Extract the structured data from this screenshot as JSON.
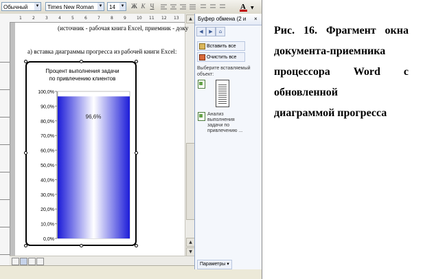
{
  "toolbar": {
    "style": "Обычный",
    "font": "Times New Roman",
    "size": "14",
    "buttons": [
      "Ж",
      "К",
      "Ч"
    ]
  },
  "ruler": {
    "marks": [
      "1",
      "2",
      "3",
      "4",
      "5",
      "6",
      "7",
      "8",
      "9",
      "10",
      "11",
      "12",
      "13"
    ]
  },
  "document": {
    "heading_line": "(источник - рабочая книга Excel, приемник - доку",
    "section_line": "а) вставка диаграммы прогресса из рабочей книги Excel:"
  },
  "chart_data": {
    "type": "bar",
    "title": "Процент выполнения задачи по привлечению клиентов",
    "title_lines": [
      "Процент выполнения задачи",
      "по привлечению клиентов"
    ],
    "categories": [
      ""
    ],
    "values": [
      96.6
    ],
    "data_label": "96,6%",
    "ylim": [
      0,
      100
    ],
    "y_ticks": [
      "0,0%",
      "10,0%",
      "20,0%",
      "30,0%",
      "40,0%",
      "50,0%",
      "60,0%",
      "70,0%",
      "80,0%",
      "90,0%",
      "100,0%"
    ],
    "y_tick_values": [
      0,
      10,
      20,
      30,
      40,
      50,
      60,
      70,
      80,
      90,
      100
    ],
    "xlabel": "",
    "ylabel": "",
    "grid": false,
    "legend": "none",
    "bar_gradient": [
      "#1c1cd8",
      "#ffffff",
      "#1c1cd8"
    ]
  },
  "task_pane": {
    "title": "Буфер обмена (2 и",
    "close": "×",
    "paste_all": "Вставить все",
    "clear_all": "Очистить все",
    "prompt": "Выберите вставляемый объект:",
    "items": [
      {
        "type": "chart-thumbnail"
      },
      {
        "lines": [
          "Анализ",
          "выполнения",
          "задачи по",
          "привлечению ..."
        ]
      }
    ],
    "options_button": "Параметры ▾"
  },
  "caption": {
    "lines": [
      [
        "Рис.",
        "16.",
        "Фрагмент",
        "окна"
      ],
      [
        "документа-приемника"
      ],
      [
        "процессора",
        "Word",
        "с"
      ],
      [
        "обновленной"
      ],
      [
        "диаграммой прогресса"
      ]
    ]
  },
  "colors": {
    "bar_blue": "#1c1cd8",
    "pane_border": "#8da2c6",
    "screen_gray": "#d4d0c8"
  }
}
